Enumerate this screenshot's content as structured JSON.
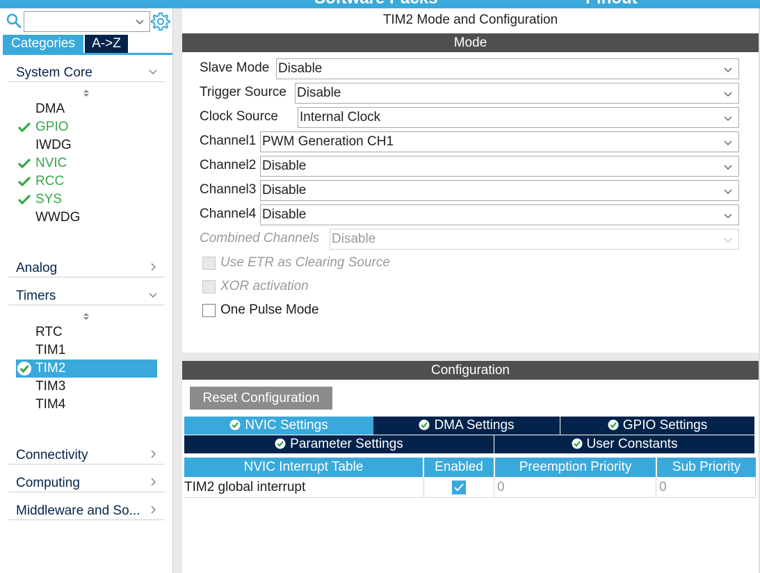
{
  "top_banner": {
    "left_text": "Software Packs",
    "right_text": "Pinout"
  },
  "sidebar": {
    "search": {
      "value": "",
      "placeholder": ""
    },
    "tabs": {
      "categories": "Categories",
      "az": "A->Z"
    },
    "categories": {
      "system_core": {
        "label": "System Core",
        "items": [
          {
            "label": "DMA",
            "checked": false
          },
          {
            "label": "GPIO",
            "checked": true
          },
          {
            "label": "IWDG",
            "checked": false
          },
          {
            "label": "NVIC",
            "checked": true
          },
          {
            "label": "RCC",
            "checked": true
          },
          {
            "label": "SYS",
            "checked": true
          },
          {
            "label": "WWDG",
            "checked": false
          }
        ]
      },
      "analog": {
        "label": "Analog"
      },
      "timers": {
        "label": "Timers",
        "items": [
          {
            "label": "RTC"
          },
          {
            "label": "TIM1"
          },
          {
            "label": "TIM2",
            "selected": true
          },
          {
            "label": "TIM3"
          },
          {
            "label": "TIM4"
          }
        ]
      },
      "connectivity": {
        "label": "Connectivity"
      },
      "computing": {
        "label": "Computing"
      },
      "middleware": {
        "label": "Middleware and So..."
      }
    }
  },
  "main": {
    "title": "TIM2 Mode and Configuration",
    "mode": {
      "header": "Mode",
      "fields": {
        "slave_mode": {
          "label": "Slave Mode",
          "value": "Disable"
        },
        "trigger_source": {
          "label": "Trigger Source",
          "value": "Disable"
        },
        "clock_source": {
          "label": "Clock Source",
          "value": "Internal Clock"
        },
        "channel1": {
          "label": "Channel1",
          "value": "PWM Generation CH1"
        },
        "channel2": {
          "label": "Channel2",
          "value": "Disable"
        },
        "channel3": {
          "label": "Channel3",
          "value": "Disable"
        },
        "channel4": {
          "label": "Channel4",
          "value": "Disable"
        },
        "combined_channels": {
          "label": "Combined Channels",
          "value": "Disable",
          "disabled": true
        }
      },
      "checkboxes": {
        "use_etr": {
          "label": "Use ETR as Clearing Source",
          "checked": false,
          "disabled": true
        },
        "xor_activation": {
          "label": "XOR activation",
          "checked": false,
          "disabled": true
        },
        "one_pulse": {
          "label": "One Pulse Mode",
          "checked": false,
          "disabled": false
        }
      }
    },
    "configuration": {
      "header": "Configuration",
      "reset_label": "Reset Configuration",
      "tabs": {
        "nvic": "NVIC Settings",
        "dma": "DMA Settings",
        "gpio": "GPIO Settings",
        "parameter": "Parameter Settings",
        "user_constants": "User Constants"
      },
      "active_tab": "NVIC Settings",
      "table": {
        "columns": [
          "NVIC Interrupt Table",
          "Enabled",
          "Preemption Priority",
          "Sub Priority"
        ],
        "rows": [
          {
            "name": "TIM2 global interrupt",
            "enabled": true,
            "preemption": "0",
            "sub": "0"
          }
        ]
      }
    }
  },
  "colors": {
    "accent": "#39a9dc",
    "navy": "#03234b",
    "section_header": "#4f4f4f",
    "check_green": "#35a846",
    "reset_button": "#8c8c8c"
  }
}
